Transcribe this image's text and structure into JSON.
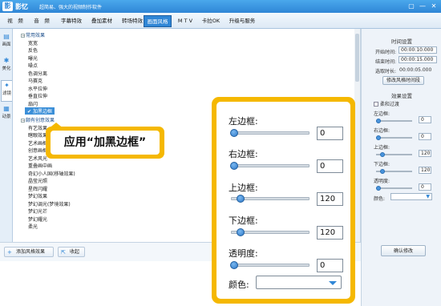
{
  "app": {
    "logo": "影",
    "name": "影忆",
    "slogan": "超简易、强大的视频制作软件",
    "window_buttons": [
      "▢",
      "—",
      "✕"
    ]
  },
  "menu": {
    "tabs": [
      "视　频",
      "音　频",
      "字幕特效",
      "叠加素材",
      "转场特效",
      "画面风格",
      "M T V",
      "卡拉OK",
      "升级与服务"
    ],
    "active": "画面风格"
  },
  "left_tabs": [
    {
      "label": "画面",
      "icon": "film-icon"
    },
    {
      "label": "美化",
      "icon": "paint-icon"
    },
    {
      "label": "滤镜",
      "icon": "wand-icon"
    },
    {
      "label": "动景",
      "icon": "scene-icon"
    }
  ],
  "tree": {
    "cat1": "常用效果",
    "cat1_items": [
      "宽宽",
      "反色",
      "曝光",
      "噪点",
      "色调分离",
      "马赛克",
      "水平拉伸",
      "垂直拉伸",
      "扇闪"
    ],
    "selected": "加黑边框",
    "cat2": "颇有创意效果",
    "cat2_items": [
      "有艺效果",
      "瞎眼效果",
      "艺术画框",
      "创意画框",
      "艺术风光",
      "重叠画中画",
      "奇幻小人国(移轴效果)",
      "晶莹光照",
      "星辉闪耀",
      "梦幻效果",
      "梦幻调光(梦境效果)",
      "梦幻光芒",
      "梦幻耀光",
      "柔光"
    ]
  },
  "bottom": {
    "add_btn": "添加风格效果",
    "fav_btn": "收起"
  },
  "right": {
    "time_title": "时间设置",
    "start_label": "开始时间:",
    "start_value": "00:00:10.000",
    "end_label": "结束时间:",
    "end_value": "00:00:15.000",
    "duration_label": "选取时长:",
    "duration_value": "00:00:05.000",
    "modify_time_btn": "修改风格时间段",
    "effect_title": "效果设置",
    "soft_label": "柔和过渡",
    "left_label": "左边框:",
    "left_value": "0",
    "right_label": "右边框:",
    "right_value": "0",
    "top_label": "上边框:",
    "top_value": "120",
    "bottom_label": "下边框:",
    "bottom_value": "120",
    "opacity_label": "透明度:",
    "opacity_value": "0",
    "color_label": "颜色:",
    "confirm_btn": "确认修改"
  },
  "callout": "应用“加黑边框”",
  "zoom": {
    "left_label": "左边框:",
    "left_value": "0",
    "right_label": "右边框:",
    "right_value": "0",
    "top_label": "上边框:",
    "top_value": "120",
    "bottom_label": "下边框:",
    "bottom_value": "120",
    "opacity_label": "透明度:",
    "opacity_value": "0",
    "color_label": "颜色:"
  },
  "colors": {
    "accent": "#2f86d6",
    "callout": "#f5b800",
    "selection": "#3b8fd8"
  }
}
